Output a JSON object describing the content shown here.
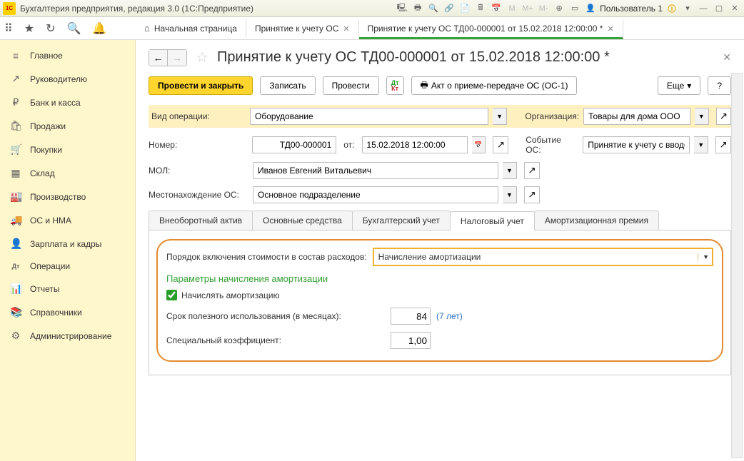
{
  "titlebar": {
    "logo": "1C",
    "title": "Бухгалтерия предприятия, редакция 3.0  (1С:Предприятие)",
    "user": "Пользователь 1"
  },
  "topbar": {
    "tabs": [
      {
        "label": "Начальная страница",
        "closable": false,
        "home": true
      },
      {
        "label": "Принятие к учету ОС",
        "closable": true
      },
      {
        "label": "Принятие к учету ОС ТД00-000001 от 15.02.2018 12:00:00 *",
        "closable": true,
        "active": true
      }
    ]
  },
  "sidebar": {
    "items": [
      {
        "icon": "≡",
        "label": "Главное"
      },
      {
        "icon": "↗",
        "label": "Руководителю"
      },
      {
        "icon": "₽",
        "label": "Банк и касса"
      },
      {
        "icon": "🛍",
        "label": "Продажи"
      },
      {
        "icon": "🛒",
        "label": "Покупки"
      },
      {
        "icon": "▦",
        "label": "Склад"
      },
      {
        "icon": "🏭",
        "label": "Производство"
      },
      {
        "icon": "🚚",
        "label": "ОС и НМА"
      },
      {
        "icon": "👤",
        "label": "Зарплата и кадры"
      },
      {
        "icon": "Дт",
        "label": "Операции"
      },
      {
        "icon": "📊",
        "label": "Отчеты"
      },
      {
        "icon": "📚",
        "label": "Справочники"
      },
      {
        "icon": "⚙",
        "label": "Администрирование"
      }
    ]
  },
  "header": {
    "title": "Принятие к учету ОС ТД00-000001 от 15.02.2018 12:00:00 *"
  },
  "toolbar": {
    "primary": "Провести и закрыть",
    "save": "Записать",
    "post": "Провести",
    "act": "Акт о приеме-передаче ОС (ОС-1)",
    "more": "Еще",
    "help": "?"
  },
  "form": {
    "op_label": "Вид операции:",
    "op_value": "Оборудование",
    "org_label": "Организация:",
    "org_value": "Товары для дома ООО",
    "num_label": "Номер:",
    "num_value": "ТД00-000001",
    "ot_label": "от:",
    "date_value": "15.02.2018 12:00:00",
    "event_label": "Событие ОС:",
    "event_value": "Принятие к учету с вводо",
    "mol_label": "МОЛ:",
    "mol_value": "Иванов Евгений Витальевич",
    "loc_label": "Местонахождение ОС:",
    "loc_value": "Основное подразделение"
  },
  "formTabs": [
    "Внеоборотный актив",
    "Основные средства",
    "Бухгалтерский учет",
    "Налоговый учет",
    "Амортизационная премия"
  ],
  "formTabActive": 3,
  "pane": {
    "order_label": "Порядок включения стоимости в состав расходов:",
    "order_value": "Начисление амортизации",
    "section_title": "Параметры начисления амортизации",
    "amort_label": "Начислять амортизацию",
    "amort_checked": true,
    "life_label": "Срок полезного использования (в месяцах):",
    "life_value": "84",
    "life_hint": "(7 лет)",
    "coef_label": "Специальный коэффициент:",
    "coef_value": "1,00"
  }
}
